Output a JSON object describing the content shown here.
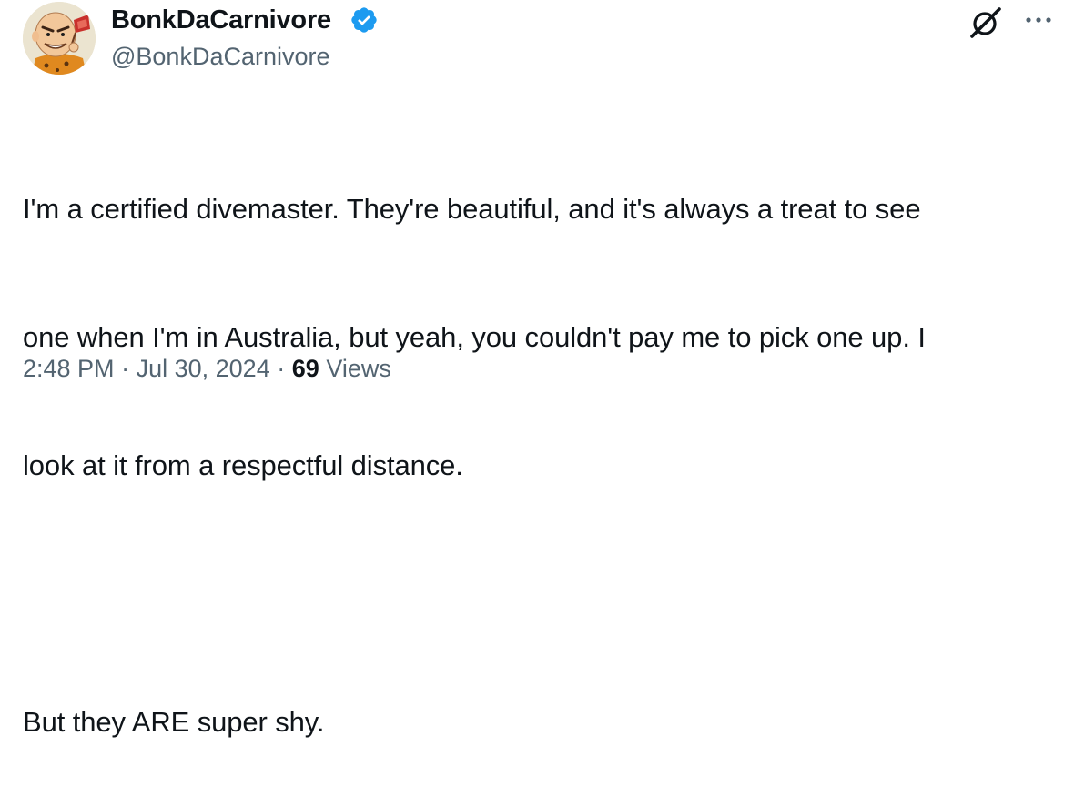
{
  "author": {
    "display_name": "BonkDaCarnivore",
    "handle": "@BonkDaCarnivore",
    "verified": true,
    "avatar_icon": "cartoon-avatar-icon"
  },
  "header_actions": {
    "grok_icon": "grok-icon",
    "more_icon": "more-icon"
  },
  "tweet": {
    "lines": [
      "I'm a certified divemaster.  They're beautiful, and it's always a treat to see",
      "one when I'm in Australia, but yeah, you couldn't pay me to pick one up.  I",
      "look at it from a respectful distance.",
      "",
      "But they ARE super shy."
    ]
  },
  "meta": {
    "time": "2:48 PM",
    "separator": "·",
    "date": "Jul 30, 2024",
    "views_count": "69",
    "views_label": "Views"
  },
  "colors": {
    "text": "#0f1419",
    "secondary": "#536471",
    "verified_badge": "#1d9bf0"
  }
}
